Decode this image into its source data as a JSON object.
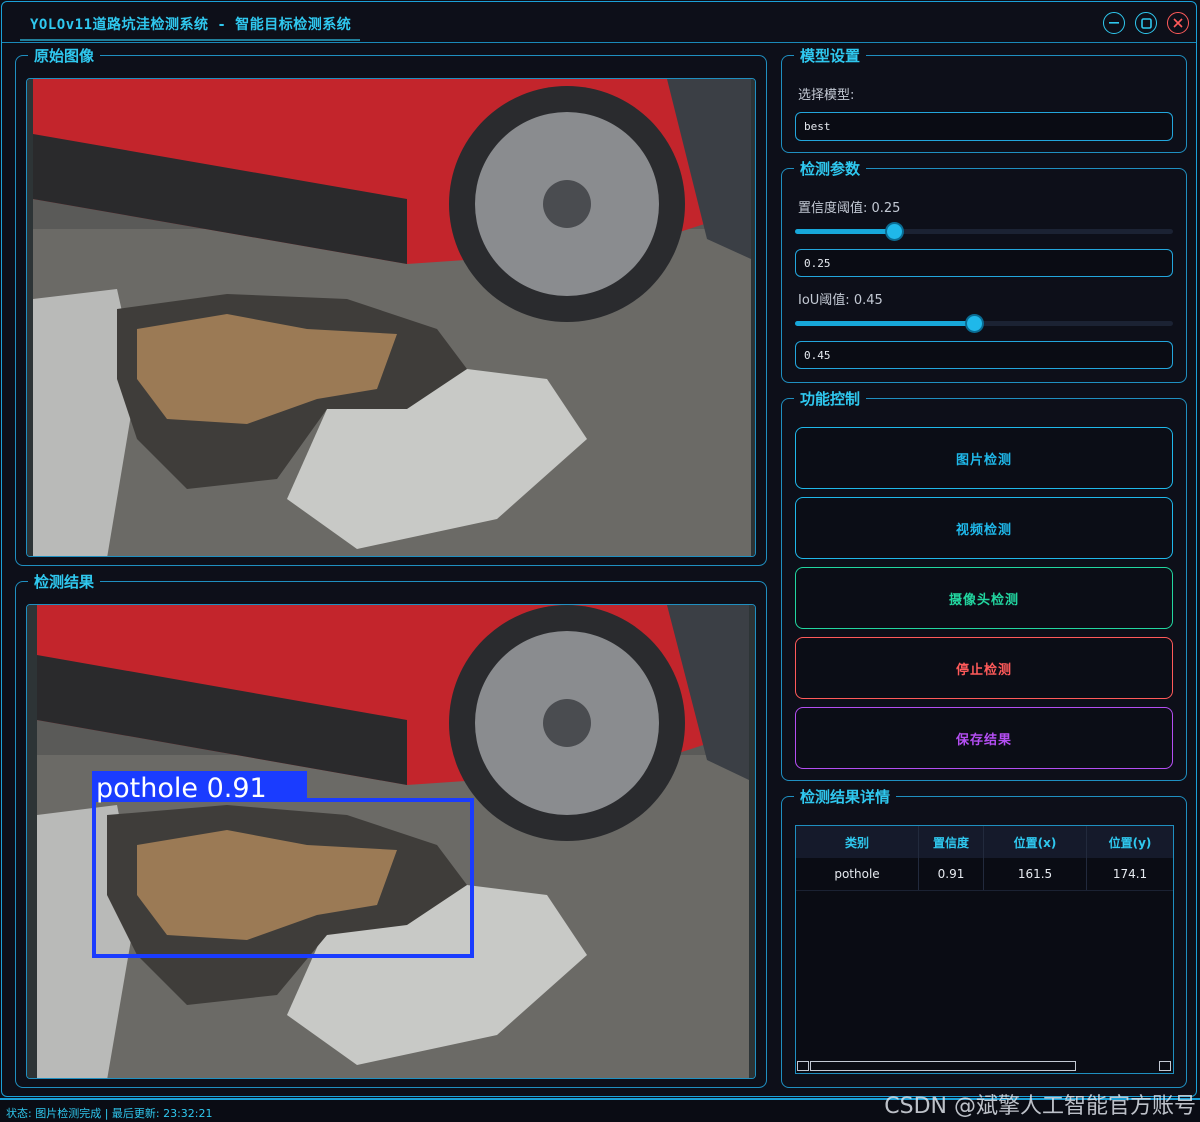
{
  "window": {
    "title": "YOLOv11道路坑洼检测系统 - 智能目标检测系统",
    "accent": "#2fc8ef"
  },
  "original_panel": {
    "title": "原始图像"
  },
  "result_panel": {
    "title": "检测结果",
    "detection_label": "pothole 0.91",
    "box_color": "#1a3cff"
  },
  "model": {
    "title": "模型设置",
    "select_label": "选择模型:",
    "selected": "best"
  },
  "params": {
    "title": "检测参数",
    "conf_label": "置信度阈值: 0.25",
    "conf_value": "0.25",
    "conf_fraction": 0.25,
    "iou_label": "IoU阈值: 0.45",
    "iou_value": "0.45",
    "iou_fraction": 0.45
  },
  "controls": {
    "title": "功能控制",
    "buttons": [
      {
        "label": "图片检测",
        "color": "#1fb8ea"
      },
      {
        "label": "视频检测",
        "color": "#1fb8ea"
      },
      {
        "label": "摄像头检测",
        "color": "#22d6a0"
      },
      {
        "label": "停止检测",
        "color": "#ff5a5a"
      },
      {
        "label": "保存结果",
        "color": "#b44ef2"
      }
    ]
  },
  "details": {
    "title": "检测结果详情",
    "columns": [
      "类别",
      "置信度",
      "位置(x)",
      "位置(y)"
    ],
    "rows": [
      [
        "pothole",
        "0.91",
        "161.5",
        "174.1"
      ]
    ]
  },
  "status": {
    "text": "状态: 图片检测完成 | 最后更新: 23:32:21"
  },
  "watermark": "CSDN @斌擎人工智能官方账号",
  "icons": [
    "minimize-icon",
    "maximize-icon",
    "close-icon"
  ]
}
